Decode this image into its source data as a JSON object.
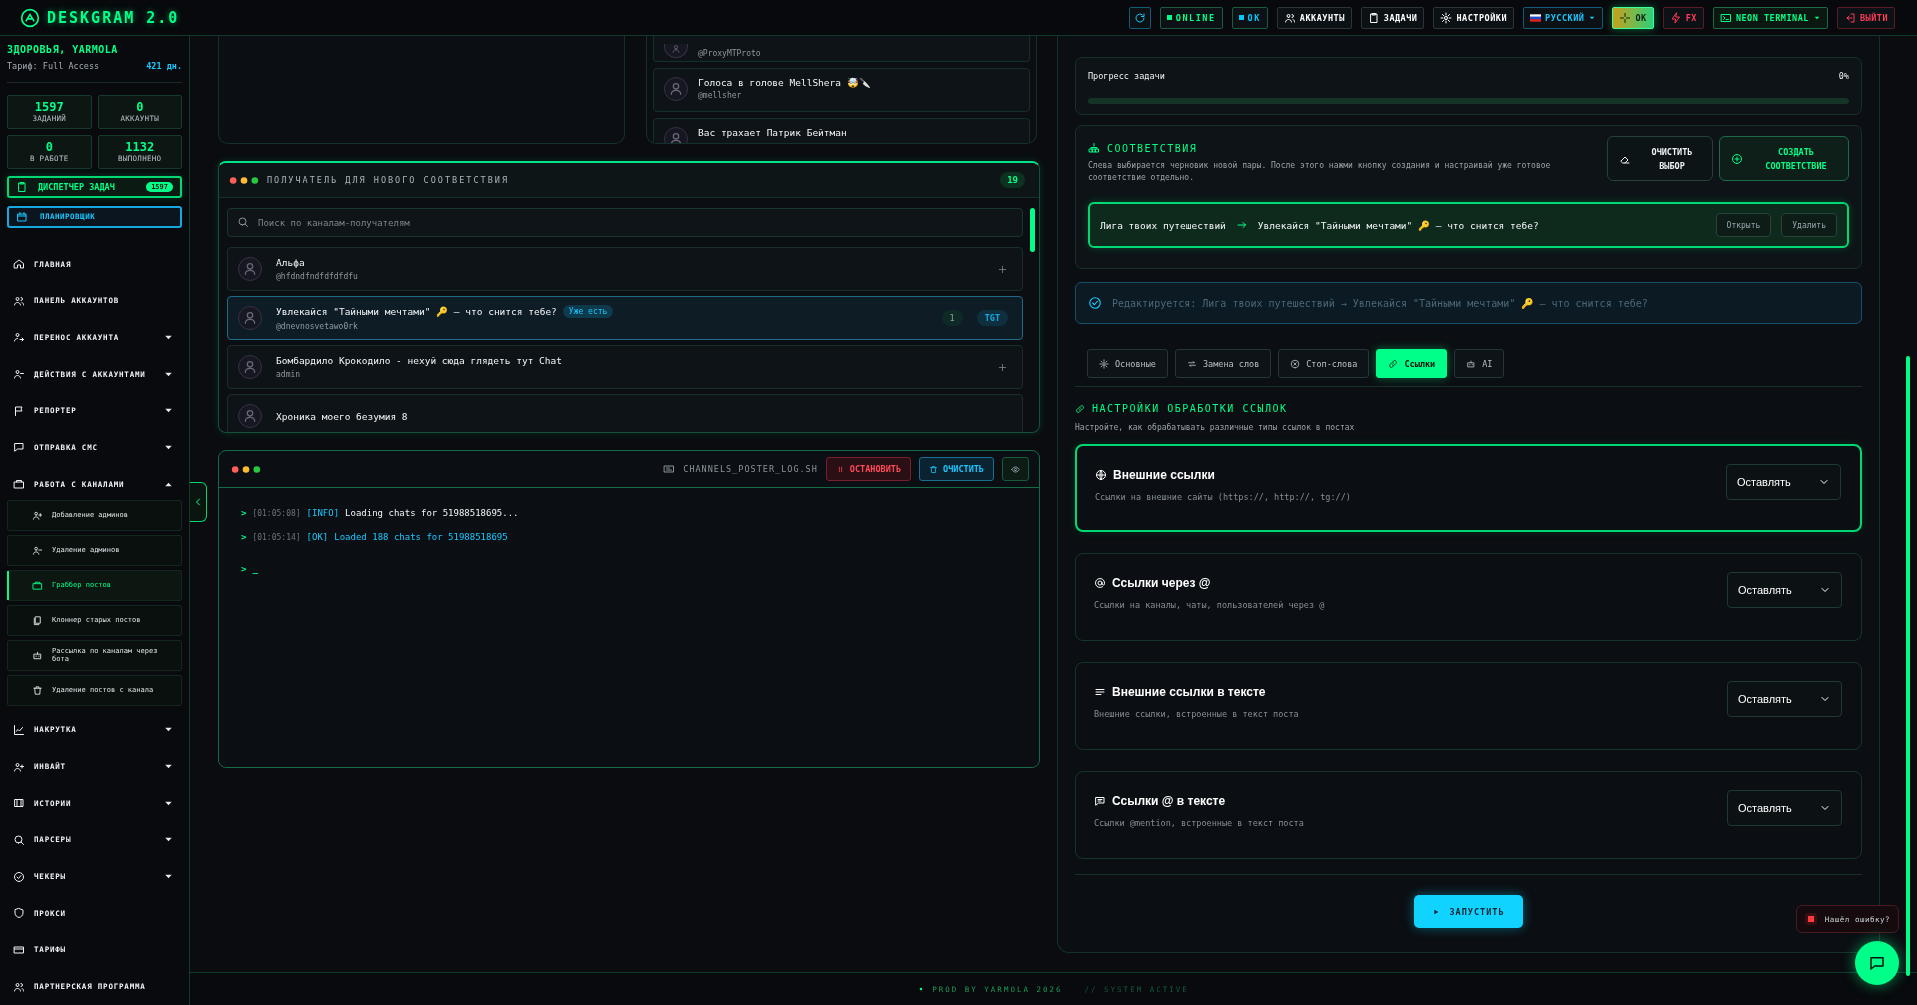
{
  "header": {
    "logo": "DESKGRAM 2.0",
    "items": [
      {
        "kind": "icon",
        "menu": false
      },
      {
        "kind": "status",
        "label": "ONLINE",
        "color": "#00ff88",
        "menu": false
      },
      {
        "kind": "status",
        "label": "OK",
        "color": "#00c8ff",
        "menu": false
      },
      {
        "kind": "nav",
        "label": "АККАУНТЫ",
        "menu": false
      },
      {
        "kind": "nav",
        "label": "ЗАДАЧИ",
        "menu": false
      },
      {
        "kind": "nav",
        "label": "НАСТРОЙКИ",
        "menu": false
      },
      {
        "kind": "lang",
        "label": "РУССКИЙ",
        "menu": true
      },
      {
        "kind": "accent",
        "label": "OK",
        "menu": false
      },
      {
        "kind": "fx",
        "label": "FX",
        "menu": false
      },
      {
        "kind": "theme",
        "label": "NEON TERMINAL",
        "menu": true
      },
      {
        "kind": "logout",
        "label": "ВЫЙТИ",
        "menu": false
      }
    ]
  },
  "sidebar": {
    "greeting": "ЗДОРОВЬЯ, YARMOLA",
    "plan": "Тариф: Full Access",
    "days": "421 дн.",
    "stats": [
      {
        "value": "1597",
        "label": "ЗАДАНИЙ"
      },
      {
        "value": "0",
        "label": "АККАУНТЫ"
      },
      {
        "value": "0",
        "label": "В РАБОТЕ"
      },
      {
        "value": "1132",
        "label": "ВЫПОЛНЕНО"
      }
    ],
    "dispatcher": {
      "label": "ДИСПЕТЧЕР ЗАДАЧ",
      "count": "1597"
    },
    "planner": "ПЛАНИРОВЩИК",
    "nav": [
      {
        "label": "ГЛАВНАЯ"
      },
      {
        "label": "ПАНЕЛЬ АККАУНТОВ"
      },
      {
        "label": "ПЕРЕНОС АККАУНТА",
        "expanded": false
      },
      {
        "label": "ДЕЙСТВИЯ С АККАУНТАМИ",
        "expanded": false
      },
      {
        "label": "РЕПОРТЕР",
        "expanded": false
      },
      {
        "label": "ОТПРАВКА СМС",
        "expanded": false
      },
      {
        "label": "РАБОТА С КАНАЛАМИ",
        "expanded": true,
        "children": [
          {
            "label": "Добавление админов",
            "selected": false
          },
          {
            "label": "Удаление админов",
            "selected": false
          },
          {
            "label": "Граббер постов",
            "selected": true
          },
          {
            "label": "Клоннер старых постов",
            "selected": false
          },
          {
            "label": "Рассылка по каналам через бота",
            "selected": false
          },
          {
            "label": "Удаление постов с канала",
            "selected": false
          }
        ]
      },
      {
        "label": "НАКРУТКА",
        "expanded": false
      },
      {
        "label": "ИНВАЙТ",
        "expanded": false
      },
      {
        "label": "ИСТОРИИ",
        "expanded": false
      },
      {
        "label": "ПАРСЕРЫ",
        "expanded": false
      },
      {
        "label": "ЧЕКЕРЫ",
        "expanded": false
      },
      {
        "label": "ПРОКСИ"
      },
      {
        "label": "ТАРИФЫ"
      },
      {
        "label": "ПАРТНЕРСКАЯ ПРОГРАММА"
      }
    ]
  },
  "sources": {
    "items": [
      {
        "handle": "@ProxyMTProto"
      },
      {
        "name": "Голоса в голове MellShera 🤯🔪",
        "handle": "@mellsher"
      },
      {
        "name": "Вас трахает Патрик Бейтман"
      }
    ]
  },
  "recipients": {
    "title": "ПОЛУЧАТЕЛЬ ДЛЯ НОВОГО СООТВЕТСТВИЯ",
    "count": "19",
    "placeholder": "Поиск по каналам-получателям",
    "items": [
      {
        "name": "Альфа",
        "handle": "@hfdndfndfdfdfdfu",
        "selected": false
      },
      {
        "name": "Увлекайся \"Тайными мечтами\" 🔑 — что снится тебе?",
        "badge": "Уже есть",
        "handle": "@dnevnosvetawo0rk",
        "count": "1",
        "tag": "TGT",
        "selected": true
      },
      {
        "name": "Бомбардило Крокодило - нехуй сюда глядеть тут Chat",
        "handle": "admin",
        "selected": false
      },
      {
        "name": "Хроника моего безумия 8",
        "selected": false
      }
    ]
  },
  "log": {
    "title": "CHANNELS_POSTER_LOG.SH",
    "buttons": [
      {
        "kind": "stop",
        "label": "ОСТАНОВИТЬ"
      },
      {
        "kind": "clear",
        "label": "ОЧИСТИТЬ"
      }
    ],
    "lines": [
      {
        "kind": "info",
        "prompt": ">",
        "time": "[01:05:08]",
        "level": "[INFO]",
        "text": "Loading chats for 51988518695..."
      },
      {
        "kind": "ok",
        "prompt": ">",
        "time": "[01:05:14]",
        "level": "[OK]",
        "text": "Loaded 188 chats for 51988518695"
      },
      {
        "kind": "input",
        "prompt": ">",
        "text": "_"
      }
    ]
  },
  "progress": {
    "label": "Прогресс задачи",
    "value": "0%",
    "level": 0
  },
  "matches": {
    "title": "СООТВЕТСТВИЯ",
    "description": "Слева выбирается черновик новой пары. После этого нажми кнопку создания и настраивай уже готовое соответствие отдельно.",
    "buttons": [
      {
        "kind": "secondary",
        "label": "ОЧИСТИТЬ ВЫБОР"
      },
      {
        "kind": "primary",
        "label": "СОЗДАТЬ СООТВЕТСТВИЕ"
      }
    ],
    "pairs": [
      {
        "source": "Лига твоих путешествий",
        "target": "Увлекайся \"Тайными мечтами\" 🔑 — что снится тебе?",
        "selected": true,
        "actions": [
          "Открыть",
          "Удалить"
        ]
      }
    ]
  },
  "editing": "Редактируется: Лига твоих путешествий → Увлекайся \"Тайными мечтами\" 🔑 — что снится тебе?",
  "tabs": [
    {
      "label": "Основные",
      "selected": false
    },
    {
      "label": "Замена слов",
      "selected": false
    },
    {
      "label": "Стоп-слова",
      "selected": false
    },
    {
      "label": "Ссылки",
      "selected": true
    },
    {
      "label": "AI",
      "selected": false
    }
  ],
  "link_settings": {
    "title": "НАСТРОЙКИ ОБРАБОТКИ ССЫЛОК",
    "description": "Настройте, как обрабатывать различные типы ссылок в постах",
    "rules": [
      {
        "title": "Внешние ссылки",
        "description": "Ссылки на внешние сайты (https://, http://, tg://)",
        "value": "Оставлять",
        "selected": true
      },
      {
        "title": "Ссылки через @",
        "description": "Ссылки на каналы, чаты, пользователей через @",
        "value": "Оставлять",
        "selected": false
      },
      {
        "title": "Внешние ссылки в тексте",
        "description": "Внешние ссылки, встроенные в текст поста",
        "value": "Оставлять",
        "selected": false
      },
      {
        "title": "Ссылки @ в тексте",
        "description": "Ссылки @mention, встроенные в текст поста",
        "value": "Оставлять",
        "selected": false
      }
    ]
  },
  "run_button": "ЗАПУСТИТЬ",
  "bug_report": "Нашёл ошибку?",
  "footer": {
    "left": "PROD BY YARMOLA 2026",
    "right": "// SYSTEM ACTIVE"
  }
}
